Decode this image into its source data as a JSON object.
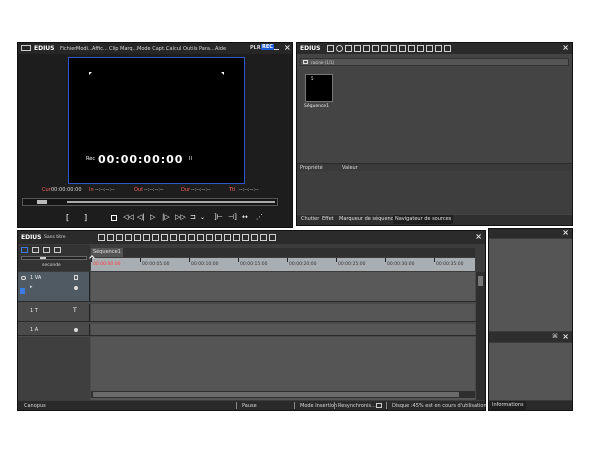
{
  "player": {
    "brand": "EDIUS",
    "menu": [
      "Fichier",
      "Modi...",
      "Affic...",
      "Clip",
      "Marq...",
      "Mode Capt...",
      "Calcul",
      "Outils",
      "Para...",
      "Aide"
    ],
    "mode_plr": "PLR",
    "mode_rec": "REC",
    "rec_label": "Rec",
    "rec_timecode": "00:00:00:00",
    "pause_symbol": "II",
    "cur_label": "Cur",
    "cur_value": "00:00:00:00",
    "in_label": "In",
    "in_value": "--:--:--:--",
    "out_label": "Out",
    "out_value": "--:--:--:--",
    "dur_label": "Dur",
    "dur_value": "--:--:--:--",
    "ttl_label": "Ttl",
    "ttl_value": "--:--:--:--"
  },
  "bin": {
    "brand": "EDIUS",
    "folder_label": "racine (1/1)",
    "clip_label": "Séquence1",
    "clip_index": "5",
    "prop_col": "Propriété",
    "value_col": "Valeur",
    "tabs": [
      "Chutier",
      "Effet",
      "Marqueur de séquence",
      "Navigateur de sources"
    ]
  },
  "timeline": {
    "brand": "EDIUS",
    "title": "Sans titre",
    "scroll_label": "seconde",
    "sequence_tab": "Séquence1",
    "ruler": [
      "00:00:00:00",
      "00:00:05:00",
      "00:00:10:00",
      "00:00:15:00",
      "00:00:20:00",
      "00:00:25:00",
      "00:00:30:00",
      "00:00:35:00"
    ],
    "tracks": [
      {
        "name": "1 VA",
        "kind": "va"
      },
      {
        "name": "1 T",
        "kind": "t"
      },
      {
        "name": "1 A",
        "kind": "a"
      }
    ]
  },
  "status": {
    "app": "Canopus",
    "state": "Pause",
    "insert_mode": "Mode Insertion",
    "sync": "Resynchronis...",
    "disk": "Disque :45% est en cours d'utilisation (C:)"
  },
  "info_panel": {
    "tab": "Informations"
  },
  "colors": {
    "accent_blue": "#1f5ad6",
    "panel": "#3a3a3a",
    "dark": "#2b2b2b",
    "ruler": "#a9aeb3",
    "red_timecode": "#ff3c3c"
  }
}
